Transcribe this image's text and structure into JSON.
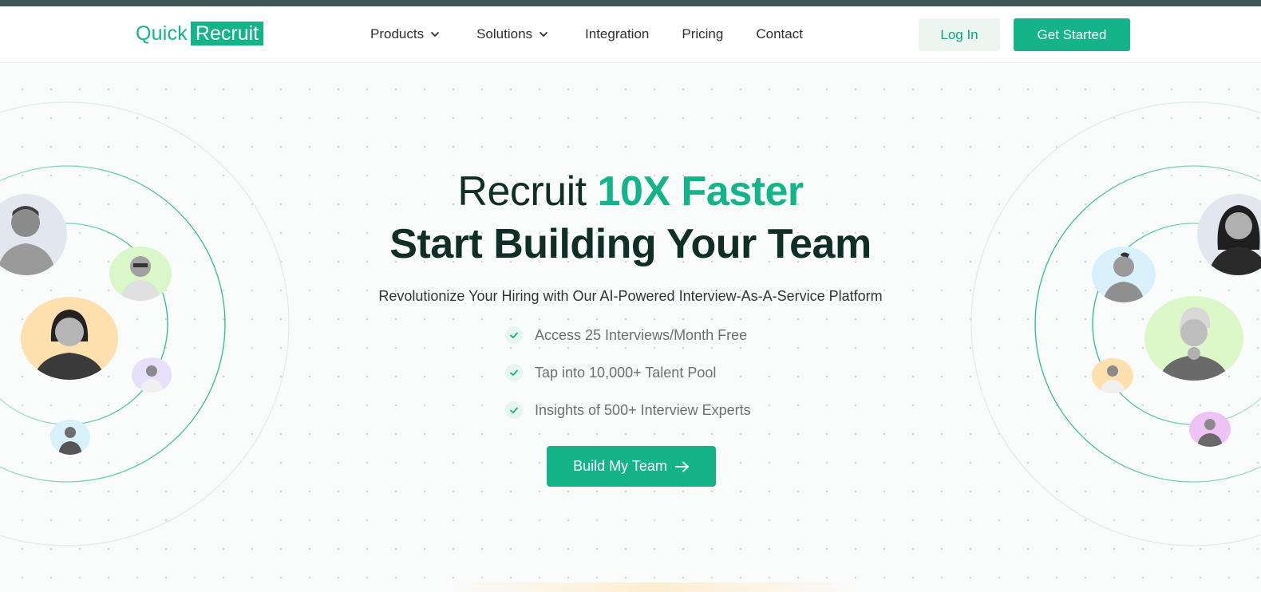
{
  "brand": {
    "logo_part1": "Quick",
    "logo_part2": "Recruit",
    "accent_color": "#13b489",
    "dark_color": "#0f2e25"
  },
  "nav": {
    "items": [
      {
        "label": "Products",
        "has_dropdown": true
      },
      {
        "label": "Solutions",
        "has_dropdown": true
      },
      {
        "label": "Integration",
        "has_dropdown": false
      },
      {
        "label": "Pricing",
        "has_dropdown": false
      },
      {
        "label": "Contact",
        "has_dropdown": false
      }
    ],
    "login_label": "Log In",
    "get_started_label": "Get Started"
  },
  "hero": {
    "title_prefix": "Recruit ",
    "title_accent": "10X Faster",
    "title_line2": "Start Building Your Team",
    "subtitle": "Revolutionize Your Hiring with Our AI-Powered Interview-As-A-Service Platform",
    "features": [
      "Access 25 Interviews/Month Free",
      "Tap into 10,000+ Talent Pool",
      "Insights of 500+ Interview Experts"
    ],
    "cta_label": "Build My Team",
    "icons": {
      "check": "check-icon",
      "cta": "arrow-right-icon",
      "nav": "chevron-down-icon"
    }
  }
}
